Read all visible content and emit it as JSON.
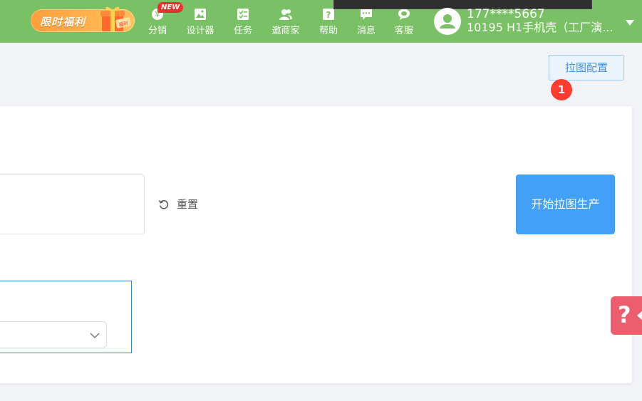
{
  "topbar": {
    "promo_label": "限时福利",
    "promo_gift_tag": "福利",
    "nav": [
      {
        "label": "分销",
        "icon": "yen-coin-icon"
      },
      {
        "label": "设计器",
        "icon": "image-icon"
      },
      {
        "label": "任务",
        "icon": "checklist-icon"
      },
      {
        "label": "邀商家",
        "icon": "users-icon"
      },
      {
        "label": "帮助",
        "icon": "question-icon"
      },
      {
        "label": "消息",
        "icon": "chat-icon"
      },
      {
        "label": "客服",
        "icon": "service-icon"
      }
    ],
    "new_badge": "NEW",
    "user": {
      "phone": "177****5667",
      "store": "10195  H1手机壳（工厂演..."
    }
  },
  "config_button": "拉图配置",
  "step_badge": "1",
  "reset_label": "重置",
  "start_button": "开始拉图生产",
  "colors": {
    "topbar_bg": "#7ac065",
    "primary_blue": "#42a0f7",
    "badge_red": "#ff3b30",
    "help_pink": "#ec5e6d",
    "promo_orange": "#ff9f3c"
  }
}
